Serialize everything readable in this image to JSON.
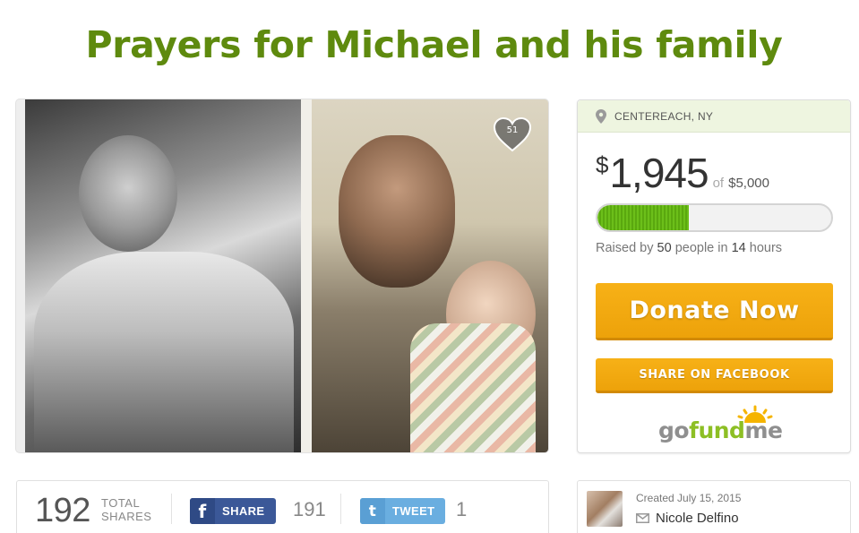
{
  "campaign": {
    "title": "Prayers for Michael and his family",
    "photo_likes": "51"
  },
  "donation_panel": {
    "location": "CENTEREACH, NY",
    "currency_symbol": "$",
    "raised_amount": "1,945",
    "of_label": "of",
    "goal": "$5,000",
    "progress_fraction": 0.389,
    "raised_prefix": "Raised by",
    "donor_count": "50",
    "people_label": "people in",
    "duration_value": "14",
    "duration_unit": "hours",
    "donate_label": "Donate Now",
    "share_facebook_label": "SHARE ON FACEBOOK",
    "logo": {
      "go": "go",
      "fund": "fund",
      "me": "me"
    }
  },
  "share_bar": {
    "total_shares": "192",
    "total_label_line1": "TOTAL",
    "total_label_line2": "SHARES",
    "facebook_label": "SHARE",
    "facebook_count": "191",
    "twitter_label": "TWEET",
    "twitter_count": "1"
  },
  "creator": {
    "created_text": "Created July 15, 2015",
    "name": "Nicole Delfino"
  },
  "colors": {
    "title_green": "#5e8a0e",
    "cta_orange": "#f2a90f",
    "progress_green": "#6cbf1a",
    "facebook_blue": "#3b5898",
    "twitter_blue": "#6aaee0"
  }
}
